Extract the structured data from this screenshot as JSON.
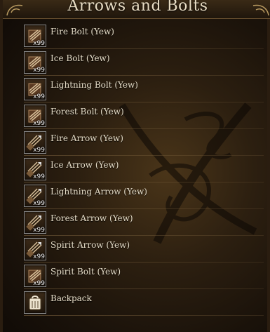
{
  "window": {
    "title": "Arrows and Bolts"
  },
  "items": [
    {
      "label": "Fire Bolt (Yew)",
      "count": "x99",
      "icon": "bolt-quiver-icon"
    },
    {
      "label": "Ice Bolt (Yew)",
      "count": "x99",
      "icon": "bolt-quiver-icon"
    },
    {
      "label": "Lightning Bolt (Yew)",
      "count": "x99",
      "icon": "bolt-quiver-icon"
    },
    {
      "label": "Forest Bolt (Yew)",
      "count": "x99",
      "icon": "bolt-quiver-icon"
    },
    {
      "label": "Fire Arrow (Yew)",
      "count": "x99",
      "icon": "arrow-bundle-icon"
    },
    {
      "label": "Ice Arrow (Yew)",
      "count": "x99",
      "icon": "arrow-bundle-icon"
    },
    {
      "label": "Lightning Arrow (Yew)",
      "count": "x99",
      "icon": "arrow-bundle-icon"
    },
    {
      "label": "Forest Arrow (Yew)",
      "count": "x99",
      "icon": "arrow-bundle-icon"
    },
    {
      "label": "Spirit Arrow (Yew)",
      "count": "x99",
      "icon": "arrow-bundle-icon"
    },
    {
      "label": "Spirit Bolt (Yew)",
      "count": "x99",
      "icon": "bolt-quiver-icon"
    },
    {
      "label": "Backpack",
      "count": "",
      "icon": "backpack-icon"
    }
  ]
}
